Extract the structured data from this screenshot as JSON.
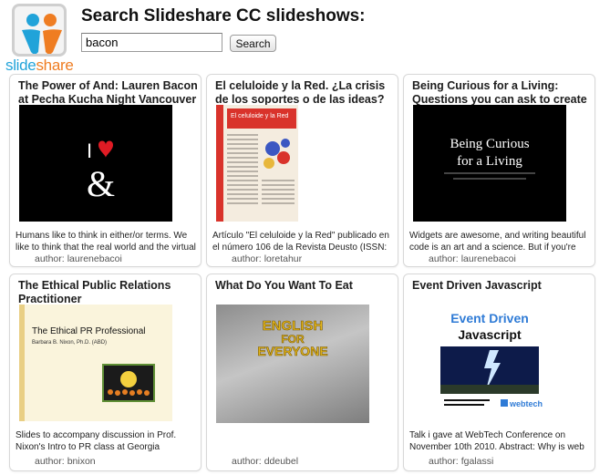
{
  "app": {
    "logo_text_1": "slide",
    "logo_text_2": "share",
    "page_title": "Search Slideshare CC slideshows:"
  },
  "search": {
    "query": "bacon",
    "placeholder": "",
    "button_label": "Search"
  },
  "author_label": "author:",
  "colors": {
    "logo_blue": "#21a3d9",
    "logo_orange": "#ef7d22",
    "card_border": "#d8d8d8",
    "event_blue": "#2f7bd6"
  },
  "cards": [
    {
      "title": "The Power of And: Lauren Bacon at Pecha Kucha Night Vancouver",
      "description": "Humans like to think in either/or terms. We like to think that the real world and the virtual",
      "author": "laurenebacoi",
      "thumb_text_1": "I",
      "thumb_text_2": "&",
      "thumb_icon": "heart-icon"
    },
    {
      "title": "El celuloide y la Red. ¿La crisis de los soportes o de las ideas?",
      "description": "Artículo \"El celuloide y la Red\" publicado en el número 106 de la Revista Deusto (ISSN:",
      "author": "loretahur",
      "thumb_text_1": "El celuloide y la Red"
    },
    {
      "title": "Being Curious for a Living: Questions you can ask to create",
      "description": "Widgets are awesome, and writing beautiful code is an art and a science. But if you're",
      "author": "laurenebacoi",
      "thumb_text_1": "Being Curious",
      "thumb_text_2": "for a Living"
    },
    {
      "title": "The Ethical Public Relations Practitioner",
      "description": "Slides to accompany discussion in Prof. Nixon's Intro to PR class at Georgia",
      "author": "bnixon",
      "thumb_text_1": "The Ethical PR Professional",
      "thumb_text_2": "Barbara B. Nixon, Ph.D. (ABD)"
    },
    {
      "title": "What Do You Want To Eat",
      "description": "",
      "author": "ddeubel",
      "thumb_text_1": "ENGLISH",
      "thumb_text_2": "FOR",
      "thumb_text_3": "EVERYONE"
    },
    {
      "title": "Event Driven Javascript",
      "description": "Talk i gave at WebTech Conference on November 10th 2010. Abstract: Why is web",
      "author": "fgalassi",
      "thumb_text_1": "Event Driven",
      "thumb_text_2": "Javascript",
      "thumb_text_3": "webtech"
    }
  ]
}
